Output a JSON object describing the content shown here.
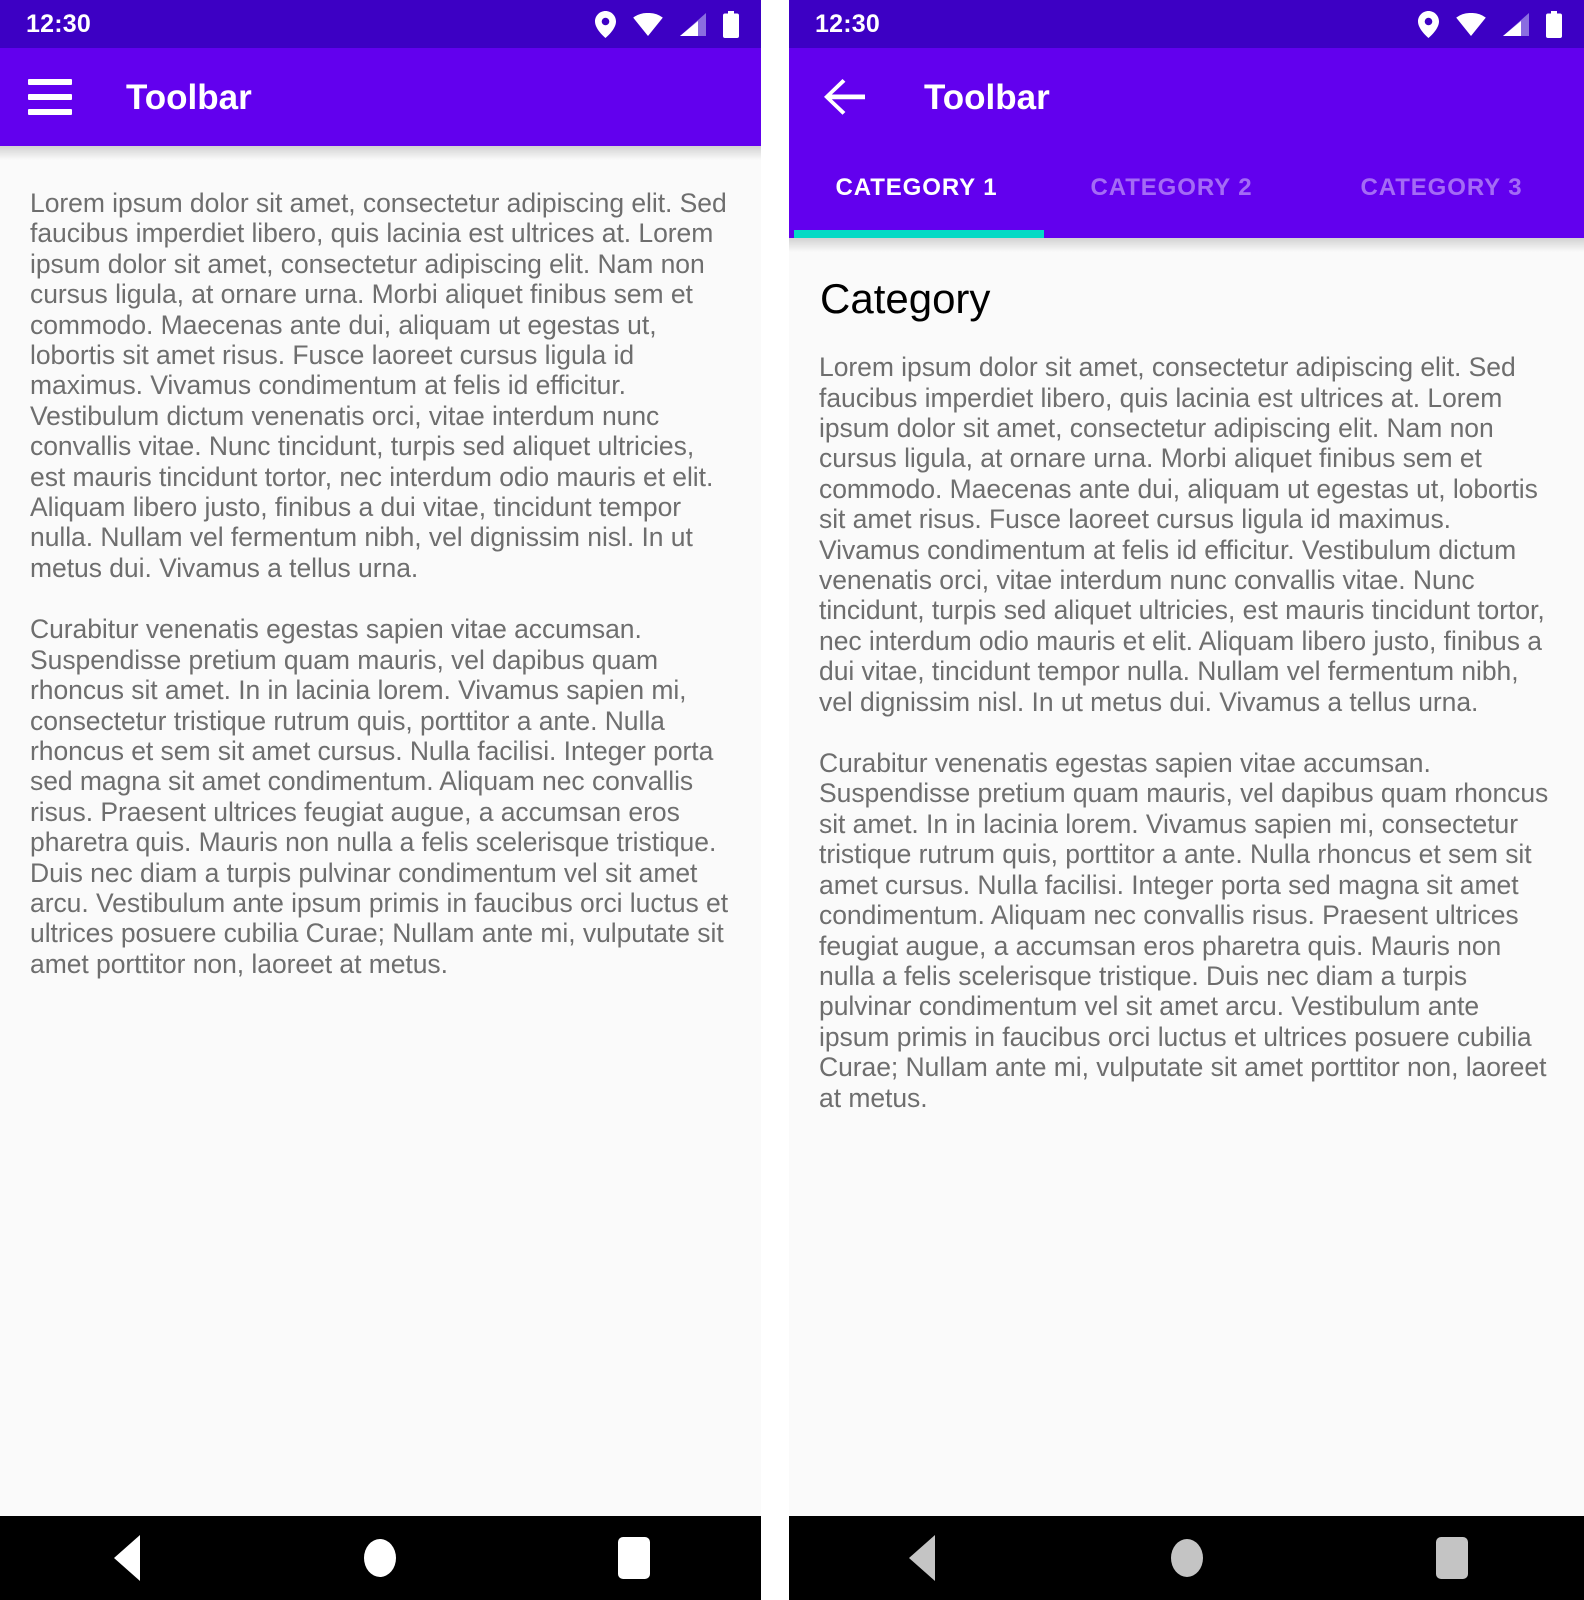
{
  "colors": {
    "status_bar": "#3d00c4",
    "toolbar": "#6200ee",
    "tab_indicator": "#03dac5",
    "content_bg": "#fafafa",
    "body_text": "#6e6e6e",
    "heading_text": "#000000",
    "nav_bar": "#000000",
    "nav_icon_active": "#ffffff",
    "nav_icon_dim": "#c4c4c4"
  },
  "status_bar": {
    "time": "12:30",
    "icons": [
      "location-pin-icon",
      "wifi-icon",
      "cell-signal-icon",
      "battery-icon"
    ]
  },
  "left_panel": {
    "toolbar": {
      "menu_icon": "hamburger-menu-icon",
      "title": "Toolbar"
    },
    "paragraphs": [
      "Lorem ipsum dolor sit amet, consectetur adipiscing elit. Sed faucibus imperdiet libero, quis lacinia est ultrices at. Lorem ipsum dolor sit amet, consectetur adipiscing elit. Nam non cursus ligula, at ornare urna. Morbi aliquet finibus sem et commodo. Maecenas ante dui, aliquam ut egestas ut, lobortis sit amet risus. Fusce laoreet cursus ligula id maximus. Vivamus condimentum at felis id efficitur. Vestibulum dictum venenatis orci, vitae interdum nunc convallis vitae. Nunc tincidunt, turpis sed aliquet ultricies, est mauris tincidunt tortor, nec interdum odio mauris et elit. Aliquam libero justo, finibus a dui vitae, tincidunt tempor nulla. Nullam vel fermentum nibh, vel dignissim nisl. In ut metus dui. Vivamus a tellus urna.",
      "Curabitur venenatis egestas sapien vitae accumsan. Suspendisse pretium quam mauris, vel dapibus quam rhoncus sit amet. In in lacinia lorem. Vivamus sapien mi, consectetur tristique rutrum quis, porttitor a ante. Nulla rhoncus et sem sit amet cursus. Nulla facilisi. Integer porta sed magna sit amet condimentum. Aliquam nec convallis risus. Praesent ultrices feugiat augue, a accumsan eros pharetra quis. Mauris non nulla a felis scelerisque tristique. Duis nec diam a turpis pulvinar condimentum vel sit amet arcu. Vestibulum ante ipsum primis in faucibus orci luctus et ultrices posuere cubilia Curae; Nullam ante mi, vulputate sit amet porttitor non, laoreet at metus."
    ],
    "bottom_nav": {
      "back": "nav-back-triangle",
      "home": "nav-home-circle",
      "recents": "nav-recents-square"
    }
  },
  "right_panel": {
    "toolbar": {
      "back_icon": "back-arrow-icon",
      "title": "Toolbar"
    },
    "tabs": [
      {
        "label": "CATEGORY 1",
        "active": true
      },
      {
        "label": "CATEGORY 2",
        "active": false
      },
      {
        "label": "CATEGORY 3",
        "active": false
      }
    ],
    "heading": "Category",
    "paragraphs": [
      "Lorem ipsum dolor sit amet, consectetur adipiscing elit. Sed faucibus imperdiet libero, quis lacinia est ultrices at. Lorem ipsum dolor sit amet, consectetur adipiscing elit. Nam non cursus ligula, at ornare urna. Morbi aliquet finibus sem et commodo. Maecenas ante dui, aliquam ut egestas ut, lobortis sit amet risus. Fusce laoreet cursus ligula id maximus. Vivamus condimentum at felis id efficitur. Vestibulum dictum venenatis orci, vitae interdum nunc convallis vitae. Nunc tincidunt, turpis sed aliquet ultricies, est mauris tincidunt tortor, nec interdum odio mauris et elit. Aliquam libero justo, finibus a dui vitae, tincidunt tempor nulla. Nullam vel fermentum nibh, vel dignissim nisl. In ut metus dui. Vivamus a tellus urna.",
      "Curabitur venenatis egestas sapien vitae accumsan. Suspendisse pretium quam mauris, vel dapibus quam rhoncus sit amet. In in lacinia lorem. Vivamus sapien mi, consectetur tristique rutrum quis, porttitor a ante. Nulla rhoncus et sem sit amet cursus. Nulla facilisi. Integer porta sed magna sit amet condimentum. Aliquam nec convallis risus. Praesent ultrices feugiat augue, a accumsan eros pharetra quis. Mauris non nulla a felis scelerisque tristique. Duis nec diam a turpis pulvinar condimentum vel sit amet arcu. Vestibulum ante ipsum primis in faucibus orci luctus et ultrices posuere cubilia Curae; Nullam ante mi, vulputate sit amet porttitor non, laoreet at metus."
    ],
    "bottom_nav": {
      "back": "nav-back-triangle",
      "home": "nav-home-circle",
      "recents": "nav-recents-square"
    }
  }
}
